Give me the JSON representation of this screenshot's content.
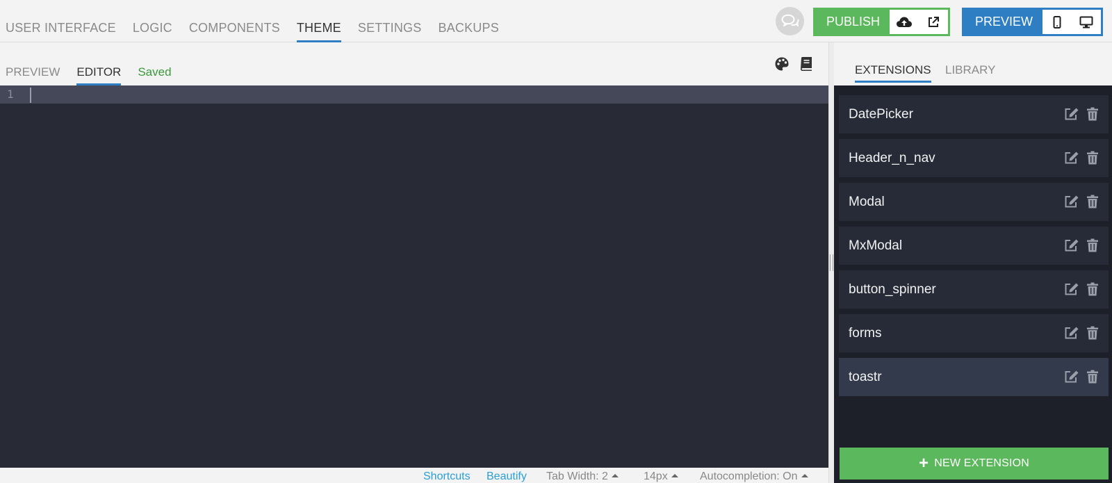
{
  "main_tabs": [
    {
      "label": "USER INTERFACE"
    },
    {
      "label": "LOGIC"
    },
    {
      "label": "COMPONENTS"
    },
    {
      "label": "THEME",
      "active": true
    },
    {
      "label": "SETTINGS"
    },
    {
      "label": "BACKUPS"
    }
  ],
  "header": {
    "publish_label": "PUBLISH",
    "preview_label": "PREVIEW",
    "publish_color": "#5cb85c",
    "preview_color": "#2d7ec3"
  },
  "editor_tabs": [
    {
      "label": "PREVIEW"
    },
    {
      "label": "EDITOR",
      "active": true
    }
  ],
  "editor": {
    "save_status": "Saved",
    "line_numbers": [
      "1"
    ],
    "tool_icons": [
      "palette-icon",
      "book-icon"
    ]
  },
  "statusbar": {
    "shortcuts": "Shortcuts",
    "beautify": "Beautify",
    "tab_width": "Tab Width: 2",
    "font_size": "14px",
    "autocompletion": "Autocompletion: On"
  },
  "right_tabs": [
    {
      "label": "EXTENSIONS",
      "active": true
    },
    {
      "label": "LIBRARY"
    }
  ],
  "extensions": [
    {
      "name": "DatePicker"
    },
    {
      "name": "Header_n_nav"
    },
    {
      "name": "Modal"
    },
    {
      "name": "MxModal"
    },
    {
      "name": "button_spinner"
    },
    {
      "name": "forms"
    },
    {
      "name": "toastr",
      "highlighted": true
    }
  ],
  "new_extension_label": "NEW EXTENSION"
}
